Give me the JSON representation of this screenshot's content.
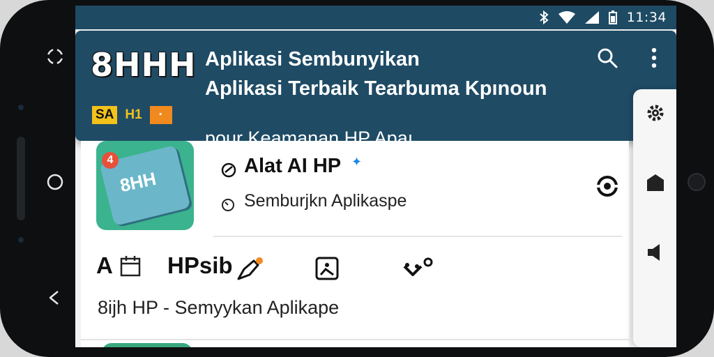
{
  "status_bar": {
    "time": "11:34"
  },
  "header": {
    "logo": "8HHH",
    "badges": [
      {
        "label": "SA",
        "bg": "#f2c21b",
        "fg": "#111111"
      },
      {
        "label": "H1",
        "bg": "#1f4b65",
        "fg": "#f2c21b"
      },
      {
        "label": "·",
        "bg": "#f08a1f",
        "fg": "#ffffff"
      }
    ],
    "title_line1": "Aplikasi Sembunyikan",
    "title_line2": "Aplikasi Terbaik Tearbuma Kpınoun",
    "subtitle": "pour Keamanan HP Apaı"
  },
  "app_card": {
    "thumb_label": "8HH",
    "thumb_badge": "4",
    "name": "Alat AI HP",
    "desc": "Semburjkn Aplikaspe"
  },
  "row2": {
    "label_a": "A",
    "label_b": "HPsib",
    "sub": "8iјh HP  -  Semyykan Aplikape"
  },
  "colors": {
    "header_bg": "#1f4b65",
    "accent_blue": "#1e88e5",
    "accent_orange": "#f08a1f",
    "thumb_green": "#3bb38e"
  }
}
